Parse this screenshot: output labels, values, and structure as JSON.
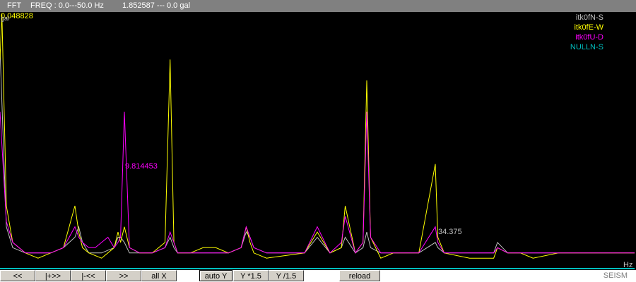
{
  "title_bar": {
    "mode": "FFT",
    "freq_label": "FREQ : 0.0---50.0 Hz",
    "amp_range": "1.852587 --- 0.0 gal"
  },
  "plot": {
    "ymax_label": "0.048828",
    "ymax_prefix": "gal",
    "unit_label": "Hz",
    "peak_label_1": "9.814453",
    "peak_label_2": "34.375",
    "colors": {
      "background": "#000000",
      "series_ns": "#c0c0c0",
      "series_ew": "#ffff00",
      "series_ud": "#ff00ff",
      "series_null": "#00c0c0"
    }
  },
  "chart_data": {
    "type": "line",
    "xlim": [
      0,
      50
    ],
    "xunit": "Hz",
    "ymax": 0.048828,
    "series": [
      {
        "name": "itk0fN-S",
        "x": [
          0,
          0.5,
          1,
          2,
          3,
          4,
          5,
          5.9,
          6.2,
          6.5,
          7,
          8,
          9,
          9.3,
          9.5,
          9.8,
          10.2,
          11,
          12,
          13,
          13.4,
          13.7,
          14,
          14.6,
          15,
          16,
          17,
          18,
          19,
          19.4,
          19.7,
          20,
          21,
          24,
          25,
          26,
          26.9,
          27.2,
          28,
          28.6,
          28.9,
          29.2,
          30,
          31,
          33,
          34.3,
          34.5,
          35,
          37,
          38.9,
          39.2,
          40,
          41,
          42,
          44,
          45,
          46,
          48,
          50
        ],
        "values": [
          0.042,
          0.008,
          0.004,
          0.003,
          0.003,
          0.003,
          0.004,
          0.006,
          0.008,
          0.005,
          0.003,
          0.003,
          0.004,
          0.006,
          0.006,
          0.005,
          0.003,
          0.003,
          0.003,
          0.004,
          0.006,
          0.004,
          0.003,
          0.003,
          0.003,
          0.003,
          0.003,
          0.003,
          0.004,
          0.007,
          0.006,
          0.004,
          0.003,
          0.003,
          0.006,
          0.003,
          0.004,
          0.006,
          0.003,
          0.004,
          0.007,
          0.004,
          0.003,
          0.003,
          0.003,
          0.005,
          0.004,
          0.003,
          0.003,
          0.003,
          0.005,
          0.003,
          0.003,
          0.003,
          0.003,
          0.003,
          0.003,
          0.003,
          0.003
        ]
      },
      {
        "name": "itk0fE-W",
        "x": [
          0,
          0.15,
          0.5,
          1,
          2,
          3,
          4,
          5,
          5.9,
          6.2,
          6.5,
          7,
          8,
          9,
          9.3,
          9.5,
          9.8,
          10.2,
          11,
          12,
          13,
          13.4,
          13.7,
          14,
          14.6,
          15,
          16,
          17,
          18,
          19,
          19.4,
          19.7,
          20,
          21,
          24,
          25,
          26,
          26.9,
          27.2,
          28,
          28.6,
          28.9,
          29.2,
          30,
          31,
          33,
          34.3,
          34.5,
          35,
          37,
          38.9,
          39.2,
          40,
          41,
          42,
          44,
          45,
          46,
          48,
          50
        ],
        "values": [
          0.04,
          0.048828,
          0.012,
          0.005,
          0.003,
          0.002,
          0.003,
          0.004,
          0.012,
          0.007,
          0.004,
          0.003,
          0.002,
          0.004,
          0.007,
          0.005,
          0.008,
          0.004,
          0.003,
          0.003,
          0.005,
          0.04,
          0.005,
          0.003,
          0.003,
          0.003,
          0.004,
          0.004,
          0.003,
          0.004,
          0.008,
          0.005,
          0.003,
          0.002,
          0.003,
          0.007,
          0.003,
          0.004,
          0.012,
          0.003,
          0.005,
          0.036,
          0.006,
          0.002,
          0.003,
          0.003,
          0.02,
          0.006,
          0.003,
          0.002,
          0.002,
          0.004,
          0.003,
          0.003,
          0.002,
          0.003,
          0.003,
          0.003,
          0.003,
          0.003
        ]
      },
      {
        "name": "itk0fU-D",
        "x": [
          0,
          0.5,
          1,
          2,
          3,
          4,
          5,
          5.9,
          6.2,
          6.5,
          7,
          7.5,
          8,
          8.5,
          9,
          9.3,
          9.5,
          9.8,
          10.2,
          11,
          12,
          13,
          13.4,
          13.7,
          14,
          14.6,
          15,
          16,
          17,
          18,
          19,
          19.4,
          19.7,
          20,
          21,
          24,
          25,
          26,
          26.9,
          27.2,
          28,
          28.6,
          28.9,
          29.2,
          30,
          31,
          33,
          34.3,
          34.5,
          35,
          37,
          38.9,
          39.2,
          40,
          41,
          42,
          44,
          45,
          46,
          48,
          50
        ],
        "values": [
          0.03,
          0.009,
          0.005,
          0.003,
          0.003,
          0.003,
          0.004,
          0.008,
          0.006,
          0.005,
          0.004,
          0.004,
          0.005,
          0.006,
          0.004,
          0.005,
          0.006,
          0.03,
          0.004,
          0.003,
          0.003,
          0.004,
          0.007,
          0.005,
          0.003,
          0.003,
          0.003,
          0.003,
          0.003,
          0.003,
          0.004,
          0.008,
          0.006,
          0.004,
          0.003,
          0.003,
          0.008,
          0.003,
          0.005,
          0.01,
          0.003,
          0.005,
          0.03,
          0.006,
          0.003,
          0.003,
          0.003,
          0.008,
          0.005,
          0.003,
          0.003,
          0.003,
          0.004,
          0.003,
          0.003,
          0.003,
          0.003,
          0.003,
          0.003,
          0.003,
          0.003
        ]
      },
      {
        "name": "NULLN-S",
        "x": [
          0,
          50
        ],
        "values": [
          0,
          0
        ]
      }
    ],
    "annotations": [
      {
        "text": "9.814453",
        "x": 9.814453
      },
      {
        "text": "34.375",
        "x": 34.375
      }
    ]
  },
  "toolbar": {
    "btn_first": "<<",
    "btn_next_page": "|+>>",
    "btn_prev_page": "|-<<",
    "btn_forward": ">>",
    "btn_all_x": "all X",
    "btn_auto_y": "auto Y",
    "btn_y_up": "Y *1.5",
    "btn_y_down": "Y /1.5",
    "btn_reload": "reload",
    "brand": "SEISM"
  }
}
